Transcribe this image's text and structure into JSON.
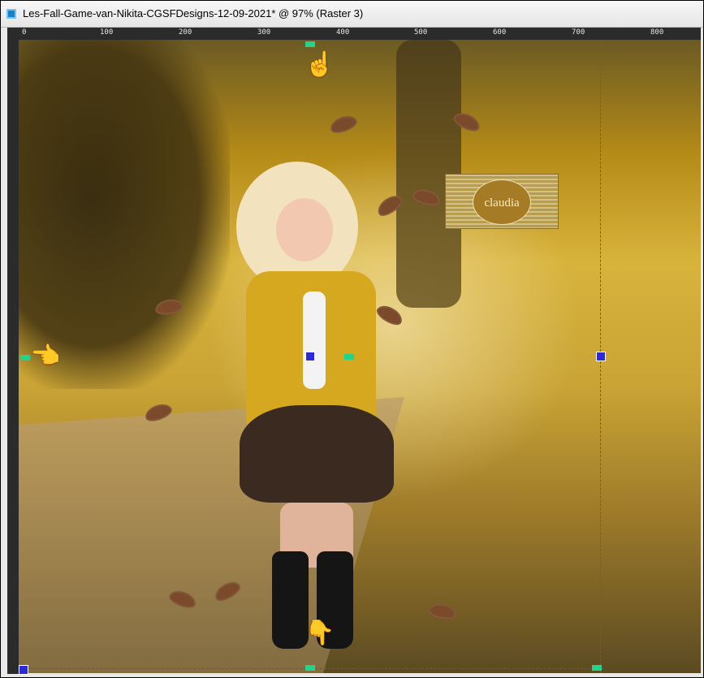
{
  "window": {
    "title": "Les-Fall-Game-van-Nikita-CGSFDesigns-12-09-2021* @  97% (Raster 3)"
  },
  "ruler": {
    "top_labels": [
      "0",
      "100",
      "200",
      "300",
      "400",
      "500",
      "600",
      "700",
      "800"
    ]
  },
  "canvas": {
    "watermark_text": "claudia"
  },
  "icons": {
    "app": "app-icon",
    "pointer": "hand-pointer-icon",
    "handle": "selection-handle-icon"
  },
  "colors": {
    "accent_gold": "#d6a81f",
    "guide_blue": "#5b4dc9",
    "handle_green": "#22d38a",
    "pointer_yellow": "#f0d000"
  }
}
